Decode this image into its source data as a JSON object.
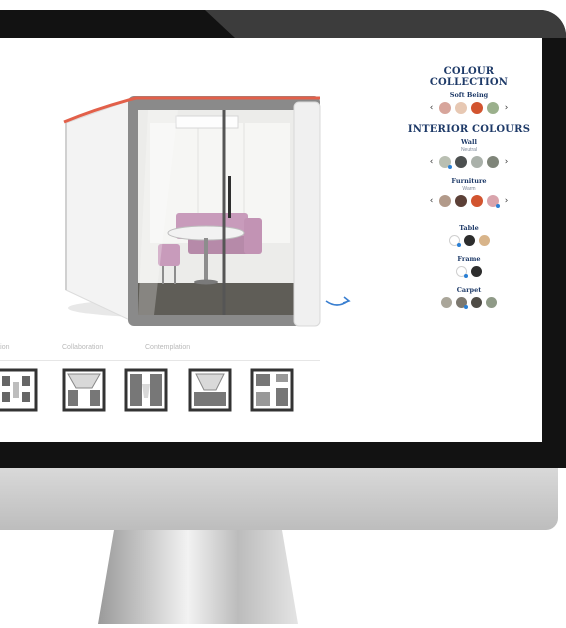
{
  "configurator": {
    "tabs": [
      "ration",
      "Collaboration",
      "Contemplation"
    ],
    "layouts_count": 5
  },
  "panel": {
    "colour_collection": {
      "title": "COLOUR COLLECTION",
      "subtitle": "Soft Being",
      "swatches": [
        "#d7a59b",
        "#e7c8b3",
        "#d2542f",
        "#9bb08c"
      ]
    },
    "interior_colours": {
      "title": "INTERIOR COLOURS",
      "wall": {
        "label": "Wall",
        "sublabel": "Neutral",
        "swatches": [
          "#b9bfb2",
          "#4c5050",
          "#aab1aa",
          "#7f8579"
        ]
      },
      "furniture": {
        "label": "Furniture",
        "sublabel": "Warm",
        "swatches": [
          "#b29a8a",
          "#5c4037",
          "#d2542f",
          "#d9a4ac"
        ]
      },
      "table": {
        "label": "Table",
        "swatches": [
          "#ffffff",
          "#2d2d2d",
          "#d8b48a"
        ]
      },
      "frame": {
        "label": "Frame",
        "swatches": [
          "#ffffff",
          "#2d2d2d"
        ]
      },
      "carpet": {
        "label": "Carpet",
        "swatches": [
          "#aaa69a",
          "#7c786f",
          "#4f4c46",
          "#8f9a87"
        ]
      }
    }
  },
  "colors": {
    "accent_red": "#e2604a",
    "heading_navy": "#1e3a68",
    "selection_dot": "#2a7fd4"
  },
  "icons": [
    "rotate-icon",
    "chevron-left-icon",
    "chevron-right-icon",
    "selected-dot-icon"
  ]
}
